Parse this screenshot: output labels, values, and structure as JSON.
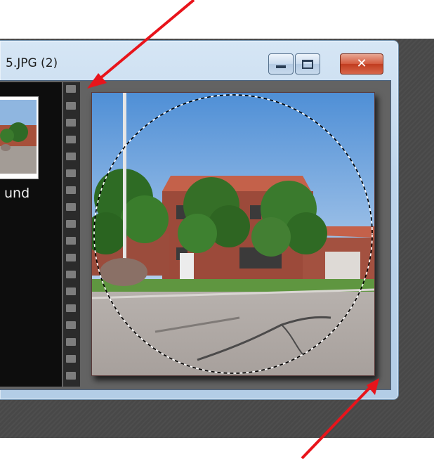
{
  "window": {
    "title": "5.JPG (2)"
  },
  "window_controls": {
    "minimize_icon": "minimize-icon",
    "maximize_icon": "maximize-icon",
    "close_icon": "close-icon",
    "close_glyph": "✕"
  },
  "sidebar": {
    "thumbnail_label": "und"
  },
  "colors": {
    "annotation_arrow": "#e8141b",
    "window_frame": "#b9d1ea",
    "close_button": "#c94a2e"
  },
  "annotations": {
    "arrow_count": 2
  }
}
